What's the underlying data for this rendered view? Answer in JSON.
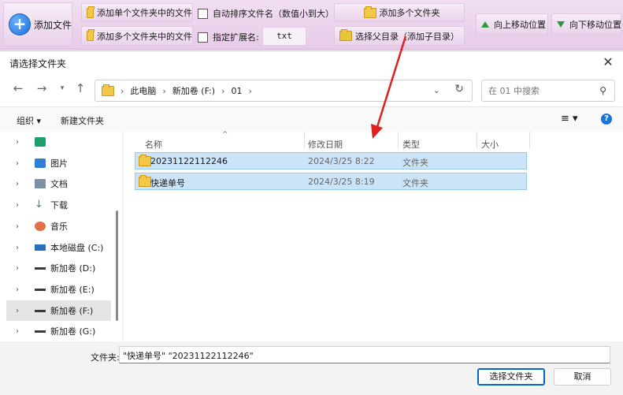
{
  "toolbar": {
    "add_file": "添加文件",
    "add_single_folder": "添加单个文件夹中的文件",
    "add_multi_folder": "添加多个文件夹中的文件",
    "auto_sort": "自动排序文件名（数值小到大）",
    "ext_label": "指定扩展名:",
    "ext_value": "txt",
    "add_multi_dirs": "添加多个文件夹",
    "select_parent": "选择父目录（添加子目录）",
    "move_up": "向上移动位置",
    "move_down": "向下移动位置"
  },
  "dialog": {
    "title": "请选择文件夹",
    "breadcrumb": [
      "此电脑",
      "新加卷 (F:)",
      "01"
    ],
    "search_placeholder": "在 01 中搜索",
    "organize": "组织 ▾",
    "new_folder": "新建文件夹",
    "help": "?"
  },
  "nav_items": [
    {
      "label": "",
      "icon": "app-icon",
      "sel": false
    },
    {
      "label": "图片",
      "icon": "pictures-icon",
      "sel": false
    },
    {
      "label": "文档",
      "icon": "documents-icon",
      "sel": false
    },
    {
      "label": "下载",
      "icon": "download-icon",
      "sel": false
    },
    {
      "label": "音乐",
      "icon": "music-icon",
      "sel": false
    },
    {
      "label": "本地磁盘 (C:)",
      "icon": "drive-icon",
      "sel": false
    },
    {
      "label": "新加卷 (D:)",
      "icon": "drive-icon",
      "sel": false
    },
    {
      "label": "新加卷 (E:)",
      "icon": "drive-icon",
      "sel": false
    },
    {
      "label": "新加卷 (F:)",
      "icon": "drive-icon",
      "sel": true
    },
    {
      "label": "新加卷 (G:)",
      "icon": "drive-icon",
      "sel": false
    }
  ],
  "columns": {
    "name": "名称",
    "date": "修改日期",
    "type": "类型",
    "size": "大小"
  },
  "files": [
    {
      "name": "20231122112246",
      "date": "2024/3/25 8:22",
      "type": "文件夹"
    },
    {
      "name": "快递单号",
      "date": "2024/3/25 8:19",
      "type": "文件夹"
    }
  ],
  "footer": {
    "filename_label": "文件夹:",
    "filename_value": "\"快递单号\" \"20231122112246\"",
    "select_button": "选择文件夹",
    "cancel_button": "取消"
  },
  "colors": {
    "annotation_arrow": "#e02020",
    "selection": "#cce4f7",
    "accent": "#0067c0"
  }
}
